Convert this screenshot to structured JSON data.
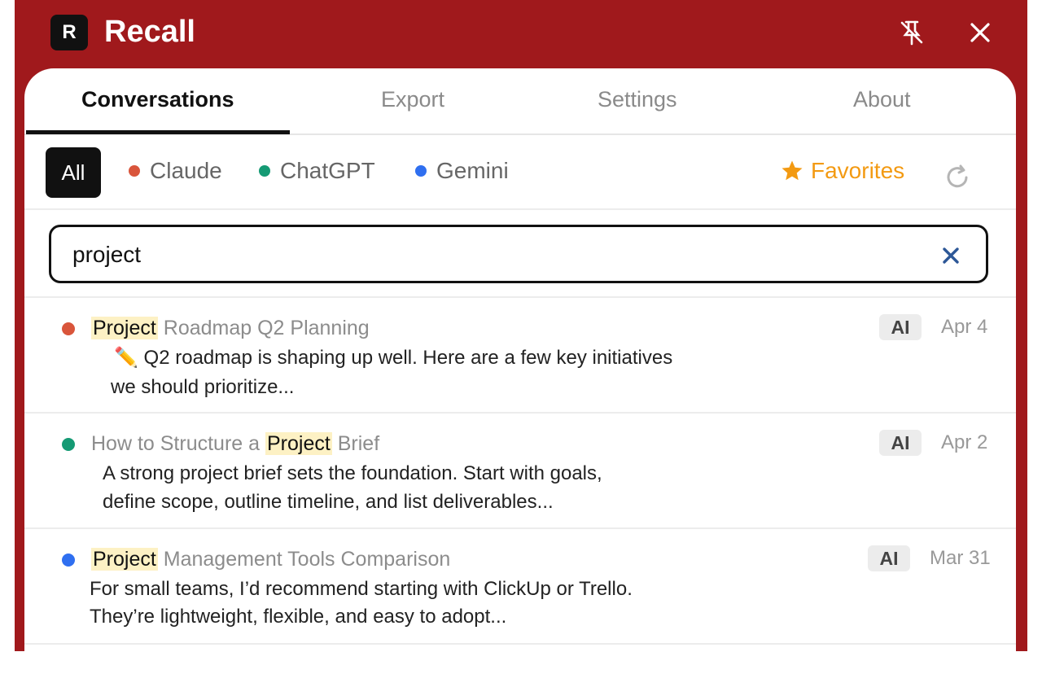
{
  "app": {
    "logo_letter": "R",
    "title": "Recall"
  },
  "header_icons": {
    "unpin": "unpin-icon",
    "close": "close-icon"
  },
  "tabs": [
    {
      "label": "Conversations",
      "active": true
    },
    {
      "label": "Export",
      "active": false
    },
    {
      "label": "Settings",
      "active": false
    },
    {
      "label": "About",
      "active": false
    }
  ],
  "filters": {
    "all_label": "All",
    "sources": [
      {
        "label": "Claude",
        "color": "#d9553b"
      },
      {
        "label": "ChatGPT",
        "color": "#159a74"
      },
      {
        "label": "Gemini",
        "color": "#2f6ff0"
      }
    ],
    "favorites_label": "Favorites",
    "favorites_icon": "star-icon",
    "favorites_color": "#f39a12",
    "refresh_icon": "refresh-icon"
  },
  "search": {
    "value": "project",
    "clear_icon": "clear-icon"
  },
  "conversations": [
    {
      "source_color": "#d9553b",
      "title_pre": "",
      "title_match": "Project",
      "title_post": " Roadmap Q2 Planning",
      "snippet_line1": "✏️ Q2 roadmap is shaping up well. Here are a few key initiatives",
      "snippet_line2": "we should prioritize...",
      "badge": "AI",
      "date": "Apr 4"
    },
    {
      "source_color": "#159a74",
      "title_pre": "How to Structure a ",
      "title_match": "Project",
      "title_post": " Brief",
      "snippet_line1": "A strong project brief sets the foundation. Start with goals,",
      "snippet_line2": "define scope, outline timeline, and list deliverables...",
      "badge": "AI",
      "date": "Apr 2"
    },
    {
      "source_color": "#2f6ff0",
      "title_pre": "",
      "title_match": "Project",
      "title_post": " Management Tools Comparison",
      "snippet_line1": "For small teams, I’d recommend starting with ClickUp or Trello.",
      "snippet_line2": "They’re lightweight, flexible, and easy to adopt...",
      "badge": "AI",
      "date": "Mar 31"
    }
  ]
}
